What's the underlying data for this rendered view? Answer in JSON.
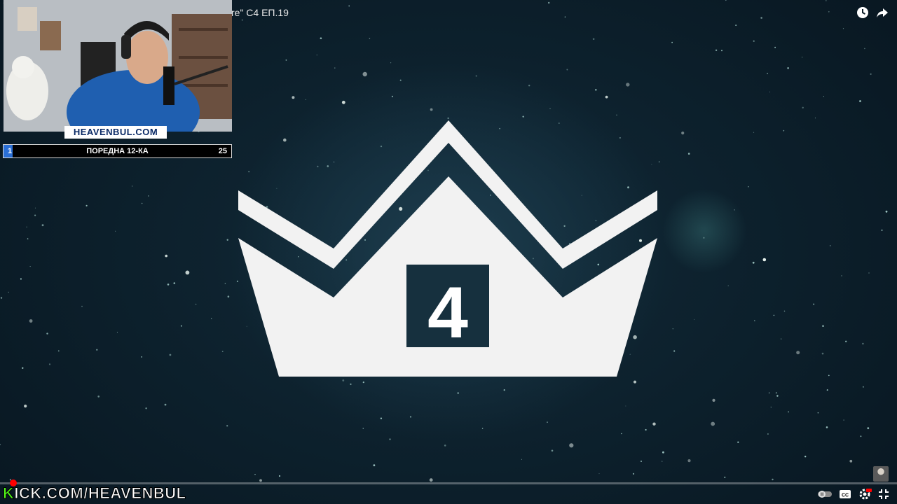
{
  "video": {
    "title_fragment": "re\" С4 ЕП.19",
    "crown_number": "4",
    "progress_fraction": 0.0
  },
  "top_icons": [
    "watch-later-icon",
    "share-icon"
  ],
  "webcam": {
    "brand": "HEAVENBUL.COM"
  },
  "goal_bar": {
    "current": "1",
    "label": "ПОРЕДНА 12-КА",
    "target": "25",
    "fill_fraction": 0.04,
    "fill_color": "#2a6fd6"
  },
  "kick_banner": {
    "k_letter": "K",
    "rest": "ICK.COM/HEAVENBUL",
    "k_color": "#53fc18"
  },
  "controls": [
    "autoplay-toggle-icon",
    "subtitles-icon",
    "settings-icon",
    "exit-fullscreen-icon"
  ],
  "colors": {
    "accent_red": "#ff0000",
    "background": "#0b1c26",
    "crown": "#f2f2f2"
  }
}
